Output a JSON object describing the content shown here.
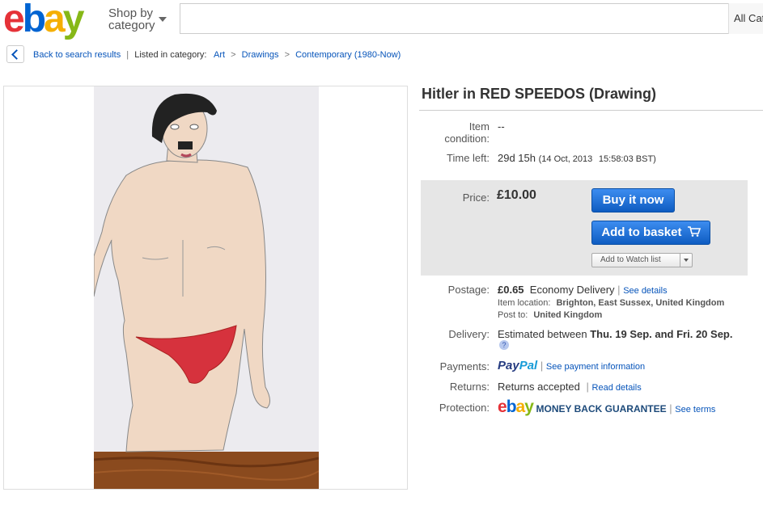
{
  "header": {
    "logo": {
      "e": "e",
      "b": "b",
      "a": "a",
      "y": "y"
    },
    "shop_by_line1": "Shop by",
    "shop_by_line2": "category",
    "search_placeholder": "",
    "category_select": "All Cat"
  },
  "breadcrumb": {
    "back_label": "Back to search results",
    "listed_in": "Listed in category:",
    "categories": [
      "Art",
      "Drawings",
      "Contemporary (1980-Now)"
    ]
  },
  "item": {
    "title": "Hitler in RED SPEEDOS (Drawing)",
    "condition_label_1": "Item",
    "condition_label_2": "condition:",
    "condition_value": "--",
    "time_left_label": "Time left:",
    "time_left_value": "29d 15h",
    "time_left_date": "(14 Oct, 2013",
    "time_left_time": "15:58:03 BST)",
    "price_label": "Price:",
    "price_value": "£10.00",
    "buy_now": "Buy it now",
    "add_to_basket": "Add to basket",
    "watch_list": "Add to Watch list"
  },
  "postage": {
    "label": "Postage:",
    "amount": "£0.65",
    "service": "Economy Delivery",
    "see_details": "See details",
    "location_label": "Item location:",
    "location_value": "Brighton, East Sussex, United Kingdom",
    "post_to_label": "Post to:",
    "post_to_value": "United Kingdom"
  },
  "delivery": {
    "label": "Delivery:",
    "text_prefix": "Estimated between",
    "dates": "Thu. 19 Sep. and Fri. 20 Sep.",
    "help": "?"
  },
  "payments": {
    "label": "Payments:",
    "paypal_1": "Pay",
    "paypal_2": "Pal",
    "link": "See payment information"
  },
  "returns": {
    "label": "Returns:",
    "value": "Returns accepted",
    "link": "Read details"
  },
  "protection": {
    "label": "Protection:",
    "logo": {
      "e": "e",
      "b": "b",
      "a": "a",
      "y": "y"
    },
    "guarantee": "MONEY BACK GUARANTEE",
    "link": "See terms"
  },
  "icons": [
    "chevron-left-icon",
    "chevron-down-icon",
    "basket-icon",
    "help-icon"
  ],
  "colors": {
    "link": "#0654ba",
    "button": "#1f6fd6",
    "price_panel": "#e6e6e6"
  }
}
